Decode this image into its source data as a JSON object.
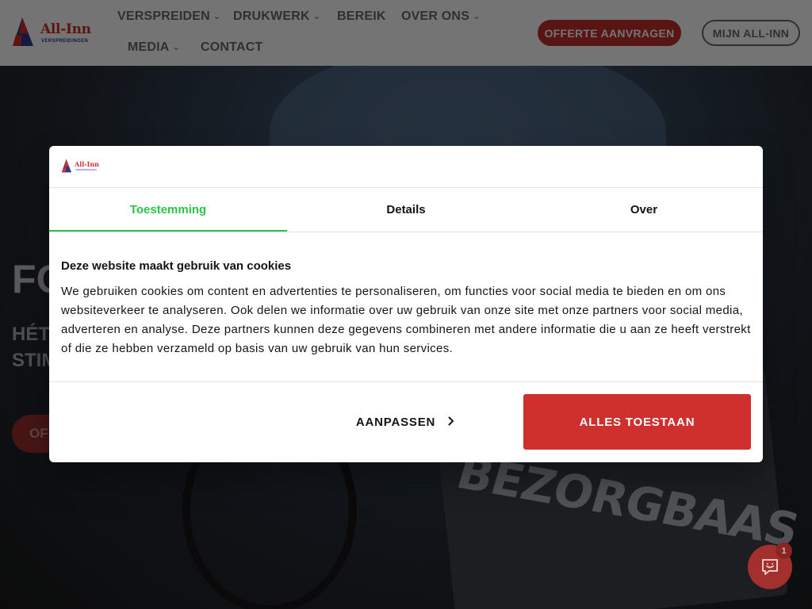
{
  "brand": {
    "name": "All-Inn",
    "tagline": "VERSPREIDINGEN",
    "accent": "#c4302b",
    "navy": "#2d3a8c"
  },
  "nav": {
    "items": [
      {
        "label": "VERSPREIDEN",
        "has_dropdown": true
      },
      {
        "label": "DRUKWERK",
        "has_dropdown": true
      },
      {
        "label": "BEREIK",
        "has_dropdown": false
      },
      {
        "label": "OVER ONS",
        "has_dropdown": true
      },
      {
        "label": "MEDIA",
        "has_dropdown": true
      },
      {
        "label": "CONTACT",
        "has_dropdown": false
      }
    ],
    "cta_primary": "OFFERTE AANVRAGEN",
    "cta_secondary": "MIJN ALL-INN"
  },
  "hero": {
    "title_partial": "FO",
    "subtitle_line1_partial": "HÉT",
    "subtitle_line2_partial": "STIM",
    "button_partial": "OF",
    "bag_text": "BEZORGBAAS"
  },
  "cookie_dialog": {
    "tabs": [
      {
        "label": "Toestemming",
        "active": true
      },
      {
        "label": "Details",
        "active": false
      },
      {
        "label": "Over",
        "active": false
      }
    ],
    "heading": "Deze website maakt gebruik van cookies",
    "body": "We gebruiken cookies om content en advertenties te personaliseren, om functies voor social media te bieden en om ons websiteverkeer te analyseren. Ook delen we informatie over uw gebruik van onze site met onze partners voor social media, adverteren en analyse. Deze partners kunnen deze gegevens combineren met andere informatie die u aan ze heeft verstrekt of die ze hebben verzameld op basis van uw gebruik van hun services.",
    "customize_label": "AANPASSEN",
    "accept_label": "ALLES TOESTAAN",
    "active_tab_color": "#2ec24a",
    "accept_color": "#d0302d"
  },
  "chat": {
    "badge_count": "1",
    "icon": "chat-smile-icon"
  }
}
